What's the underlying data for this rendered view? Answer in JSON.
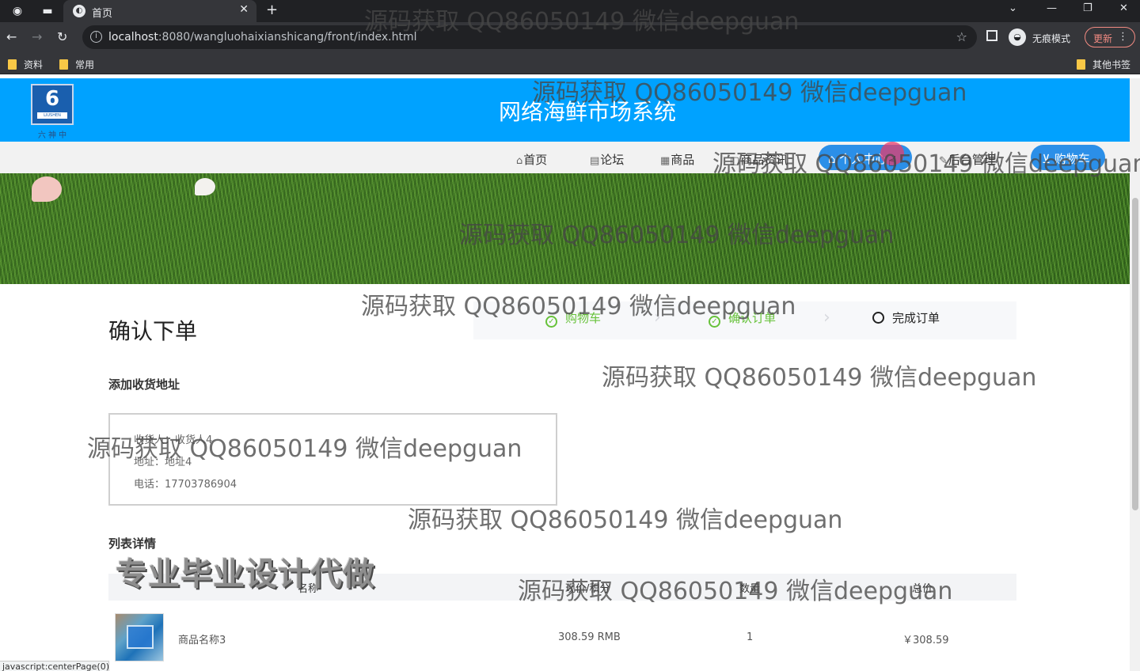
{
  "browser": {
    "tab_title": "首页",
    "url_host": "localhost",
    "url_rest": ":8080/wangluohaixianshicang/front/index.html",
    "incognito_label": "无痕模式",
    "update_label": "更新",
    "bookmarks": [
      "资料",
      "常用"
    ],
    "other_bookmarks": "其他书签",
    "status_url": "javascript:centerPage(0);"
  },
  "header": {
    "site_title": "网络海鲜市场系统",
    "logo_text": "6",
    "logo_brand": "LIUSHEN",
    "logo_sub": "六 神 中"
  },
  "nav": {
    "items": [
      "首页",
      "论坛",
      "商品",
      "商品资讯",
      "个人中心",
      "后台管理",
      "购物车"
    ]
  },
  "order": {
    "title": "确认下单",
    "steps": [
      "购物车",
      "确认订单",
      "完成订单"
    ],
    "address_section": "添加收货地址",
    "address": {
      "receiver": "收货人：收货人4",
      "addr": "地址：地址4",
      "phone": "电话：17703786904"
    },
    "list_section": "列表详情",
    "columns": [
      "名称",
      "现价/积分",
      "数量",
      "总价"
    ],
    "rows": [
      {
        "name": "商品名称3",
        "price": "308.59 RMB",
        "qty": "1",
        "total": "￥308.59"
      }
    ]
  },
  "overlays": {
    "watermark": "源码获取 QQ86050149 微信deepguan",
    "promo": "专业毕业设计代做"
  },
  "colors": {
    "header_blue": "#00a2ff",
    "pill_blue": "#2b8fe8",
    "step_done_green": "#67c23a"
  }
}
